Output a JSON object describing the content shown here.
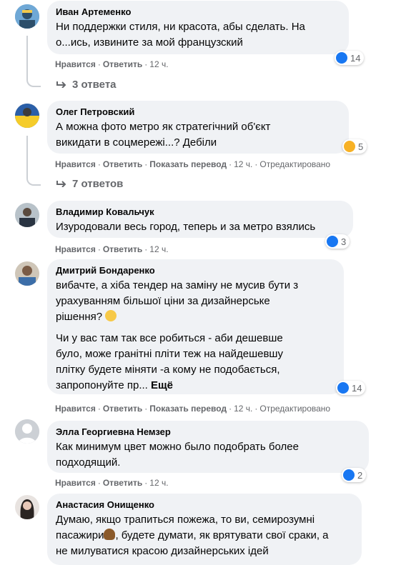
{
  "comments": [
    {
      "author": "Иван Артеменко",
      "text": "Ни поддержки стиля, ни красота, абы сделать. На\nо...ись, извините за мой французский",
      "like": "Нравится",
      "reply": "Ответить",
      "time": "12 ч.",
      "reactions": "14",
      "replies": "3 ответа"
    },
    {
      "author": "Олег Петровский",
      "text": "А можна фото метро як стратегічний об'єкт\nвикидати в соцмережі...? Дебіли",
      "like": "Нравится",
      "reply": "Ответить",
      "translate": "Показать перевод",
      "time": "12 ч.",
      "edited": "Отредактировано",
      "reactions": "5",
      "replies": "7 ответов"
    },
    {
      "author": "Владимир Ковальчук",
      "text": "Изуродовали весь город, теперь и за метро взялись",
      "like": "Нравится",
      "reply": "Ответить",
      "time": "12 ч.",
      "reactions": "3"
    },
    {
      "author": "Дмитрий Бондаренко",
      "text": "вибачте, а хіба тендер на заміну не мусив бути з\nурахуванням більшої ціни за дизайнерське\nрішення?",
      "text2": "Чи у вас там так все робиться - аби дешевше\nбуло, може гранітні пліти теж на найдешевшу\nплітку будете міняти -а кому не подобається,\nзапропонуйте пр...",
      "more": "Ещё",
      "like": "Нравится",
      "reply": "Ответить",
      "translate": "Показать перевод",
      "time": "12 ч.",
      "edited": "Отредактировано",
      "reactions": "14"
    },
    {
      "author": "Элла Георгиевна Немзер",
      "text": "Как минимум цвет можно было подобрать более\nподходящий.",
      "like": "Нравится",
      "reply": "Ответить",
      "time": "12 ч.",
      "reactions": "2"
    },
    {
      "author": "Анастасия Онищенко",
      "text": "Думаю, якщо трапиться пожежа, то ви, семирозумні\nпасажири",
      "text_b": ", будете думати, як врятувати свої сраки, а\nне милуватися красою дизайнерських ідей"
    }
  ],
  "dot": "·",
  "colors": {
    "bubble": "#f0f2f5",
    "meta": "#65676b",
    "like": "#1877f2"
  }
}
